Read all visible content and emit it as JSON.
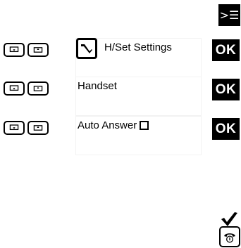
{
  "menu_key": {
    "icon": "menu-icon",
    "glyph": ">☰"
  },
  "rows": [
    {
      "label": "H/Set Settings",
      "action": "OK"
    },
    {
      "label": "Handset",
      "action": "OK"
    },
    {
      "label": "Auto Answer",
      "action": "OK",
      "checkbox_checked": false
    }
  ],
  "icons": {
    "down": "down-arrow-key-icon",
    "up": "up-arrow-key-icon",
    "wrench": "wrench-icon",
    "check": "checkmark-icon",
    "phone": "phone-end-key-icon"
  }
}
